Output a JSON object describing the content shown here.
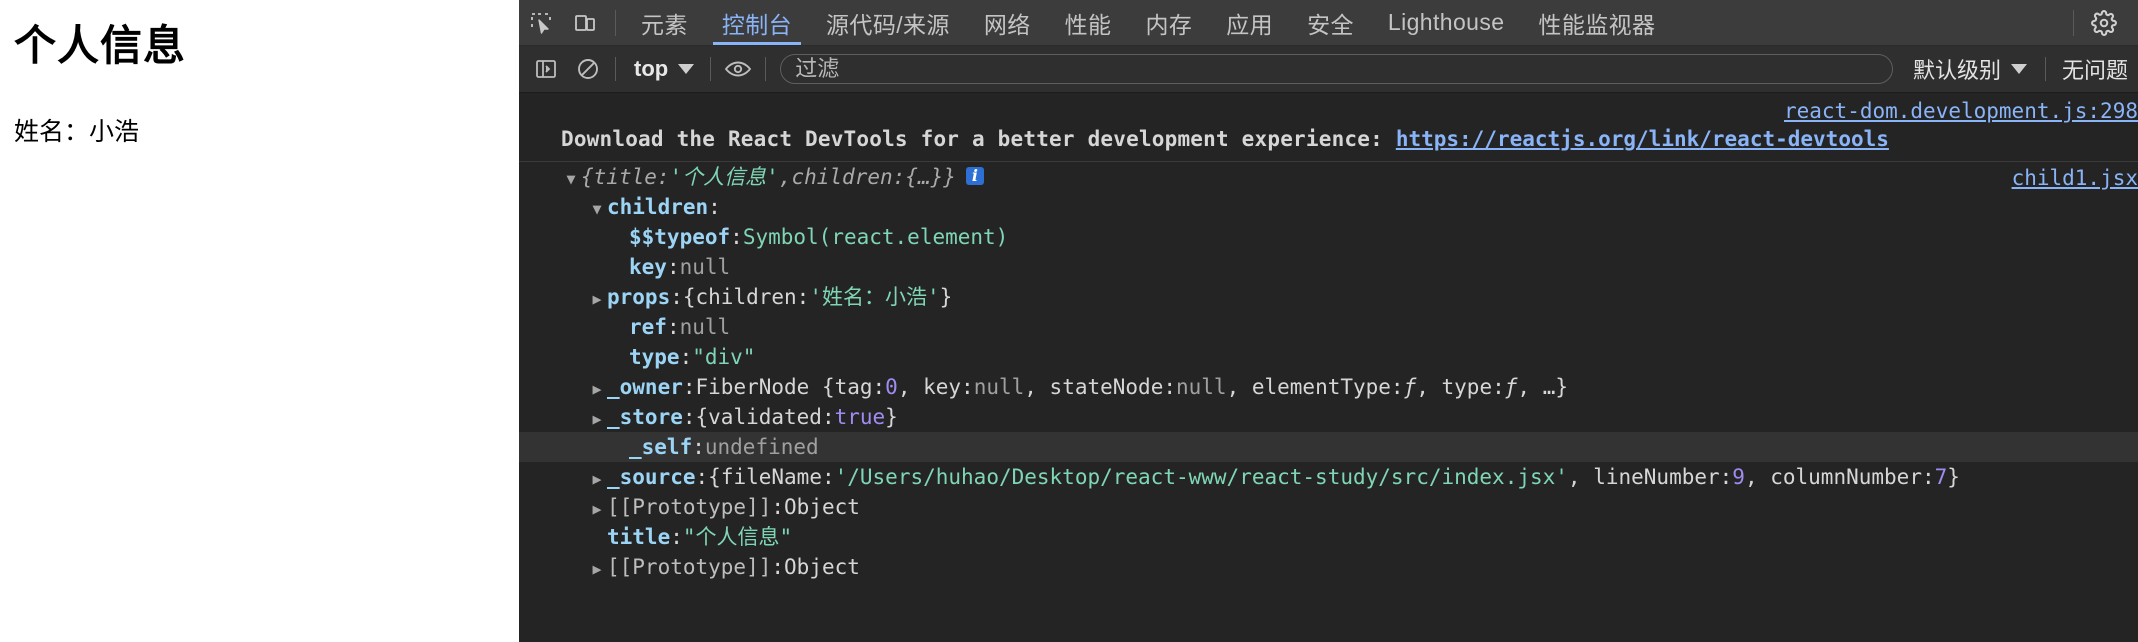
{
  "page": {
    "title": "个人信息",
    "name_line": "姓名：小浩"
  },
  "devtools": {
    "icons": {
      "inspect": "inspect-element-icon",
      "device": "device-toolbar-icon",
      "settings": "gear-icon",
      "sidebar": "console-sidebar-icon",
      "clear": "clear-console-icon",
      "eye": "live-expression-eye-icon"
    },
    "tabs": [
      {
        "label": "元素",
        "active": false,
        "latin": false
      },
      {
        "label": "控制台",
        "active": true,
        "latin": false
      },
      {
        "label": "源代码/来源",
        "active": false,
        "latin": false
      },
      {
        "label": "网络",
        "active": false,
        "latin": false
      },
      {
        "label": "性能",
        "active": false,
        "latin": false
      },
      {
        "label": "内存",
        "active": false,
        "latin": false
      },
      {
        "label": "应用",
        "active": false,
        "latin": false
      },
      {
        "label": "安全",
        "active": false,
        "latin": false
      },
      {
        "label": "Lighthouse",
        "active": false,
        "latin": true
      },
      {
        "label": "性能监视器",
        "active": false,
        "latin": false
      }
    ],
    "filterbar": {
      "context": "top",
      "filter_placeholder": "过滤",
      "filter_value": "",
      "level": "默认级别",
      "issues": "无问题"
    },
    "console": {
      "devtools_message": {
        "text": "Download the React DevTools for a better development experience: ",
        "link": "https://reactjs.org/link/react-devtools",
        "source": "react-dom.development.js:298"
      },
      "object_log": {
        "source": "child1.jsx",
        "header": {
          "open_brace": "{",
          "k_title": "title",
          "colon": ": ",
          "v_title": "'个人信息'",
          "comma": ", ",
          "k_children": "children",
          "v_children": "{…}",
          "close_brace": "}",
          "info_badge": "i"
        },
        "children_label": "children",
        "rows": [
          {
            "indent": 3,
            "arrow": "none",
            "key": "$$typeof",
            "keyclass": "k-name",
            "sep": ": ",
            "value": "Symbol(react.element)",
            "valclass": "v-sym"
          },
          {
            "indent": 3,
            "arrow": "none",
            "key": "key",
            "keyclass": "k-name",
            "sep": ": ",
            "value": "null",
            "valclass": "v-null"
          },
          {
            "indent": 2,
            "arrow": "closed",
            "key": "props",
            "keyclass": "k-name",
            "sep": ": ",
            "value": "{children: ' 姓名：小浩 '}",
            "valclass": "v-plain"
          },
          {
            "indent": 3,
            "arrow": "none",
            "key": "ref",
            "keyclass": "k-name",
            "sep": ": ",
            "value": "null",
            "valclass": "v-null"
          },
          {
            "indent": 3,
            "arrow": "none",
            "key": "type",
            "keyclass": "k-name",
            "sep": ": ",
            "value": "\"div\"",
            "valclass": "v-str"
          },
          {
            "indent": 2,
            "arrow": "closed",
            "key": "_owner",
            "keyclass": "k-name",
            "sep": ": ",
            "value": "FiberNode {tag: 0, key: null, stateNode: null, elementType: ƒ, type: ƒ, …}",
            "valclass": "v-plain"
          },
          {
            "indent": 2,
            "arrow": "closed",
            "key": "_store",
            "keyclass": "k-name",
            "sep": ": ",
            "value": "{validated: true}",
            "valclass": "v-plain"
          },
          {
            "indent": 3,
            "arrow": "none",
            "key": "_self",
            "keyclass": "k-name",
            "sep": ": ",
            "value": "undefined",
            "valclass": "v-null",
            "highlight": true
          },
          {
            "indent": 2,
            "arrow": "closed",
            "key": "_source",
            "keyclass": "k-name",
            "sep": ": ",
            "value": "{fileName: '/Users/huhao/Desktop/react-www/react-study/src/index.jsx', lineNumber: 9, columnNumber: 7}",
            "valclass": "v-plain"
          },
          {
            "indent": 2,
            "arrow": "closed",
            "key": "[[Prototype]]",
            "keyclass": "proto",
            "sep": ": ",
            "value": "Object",
            "valclass": "v-plain"
          },
          {
            "indent": 3,
            "arrow": "none",
            "key": "title",
            "keyclass": "k-name",
            "sep": ": ",
            "value": "\"个人信息\"",
            "valclass": "v-str"
          },
          {
            "indent": 2,
            "arrow": "closed",
            "key": "[[Prototype]]",
            "keyclass": "proto",
            "sep": ": ",
            "value": "Object",
            "valclass": "v-plain"
          }
        ],
        "fragments": {
          "props_pre": "{children: ",
          "props_str": "'姓名：小浩'",
          "props_post": "}",
          "owner_pre": "FiberNode {tag: ",
          "owner_tag": "0",
          "owner_mid1": ", key: ",
          "owner_key": "null",
          "owner_mid2": ", stateNode: ",
          "owner_sn": "null",
          "owner_mid3": ", elementType: ",
          "owner_f1": "ƒ",
          "owner_mid4": ", type: ",
          "owner_f2": "ƒ",
          "owner_end": ", …}",
          "store_pre": "{validated: ",
          "store_val": "true",
          "store_post": "}",
          "source_pre": "{fileName: ",
          "source_file": "'/Users/huhao/Desktop/react-www/react-study/src/index.jsx'",
          "source_mid": ", lineNumber: ",
          "source_line": "9",
          "source_mid2": ", columnNumber: ",
          "source_col": "7",
          "source_post": "}"
        }
      }
    },
    "colors": {
      "accent": "#8ab4f8",
      "tabbar_bg": "#3c3c3c",
      "filterbar_bg": "#2f2f2f",
      "console_bg": "#242424",
      "string": "#7fd6b5",
      "key": "#9bd4f5",
      "number": "#a08cf0"
    }
  }
}
